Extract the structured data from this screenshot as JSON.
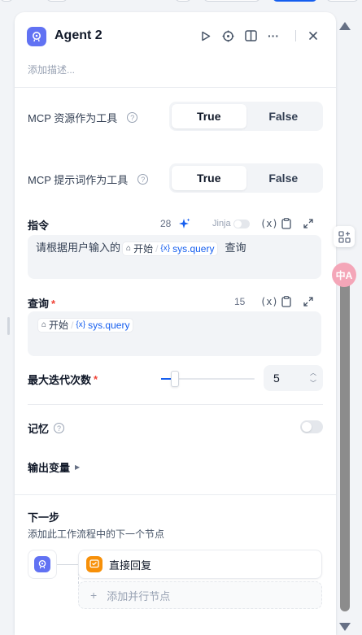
{
  "header": {
    "title": "Agent 2",
    "description_placeholder": "添加描述..."
  },
  "settings": {
    "mcp_resources": {
      "label": "MCP 资源作为工具",
      "options": [
        "True",
        "False"
      ],
      "selected": "True"
    },
    "mcp_prompts": {
      "label": "MCP 提示词作为工具",
      "options": [
        "True",
        "False"
      ],
      "selected": "True"
    }
  },
  "instruction": {
    "label": "指令",
    "char_count": "28",
    "jinja_label": "Jinja",
    "text_before": "请根据用户输入的",
    "var_node": "开始",
    "var_name": "sys.query",
    "text_after": "查询"
  },
  "query": {
    "label": "查询",
    "required_mark": "*",
    "char_count": "15",
    "var_node": "开始",
    "var_name": "sys.query"
  },
  "max_iterations": {
    "label": "最大迭代次数",
    "required_mark": "*",
    "value": "5",
    "slider_fraction": 0.15
  },
  "memory": {
    "label": "记忆",
    "enabled": false
  },
  "output_vars": {
    "label": "输出变量"
  },
  "next_step": {
    "title": "下一步",
    "subtitle": "添加此工作流程中的下一个节点",
    "node_label": "直接回复",
    "add_parallel_label": "添加并行节点"
  },
  "side": {
    "badge_text": "中A"
  },
  "colors": {
    "accent": "#155eef",
    "agent_icon": "#6172f3",
    "reply_icon": "#f79009",
    "required": "#f04438"
  }
}
